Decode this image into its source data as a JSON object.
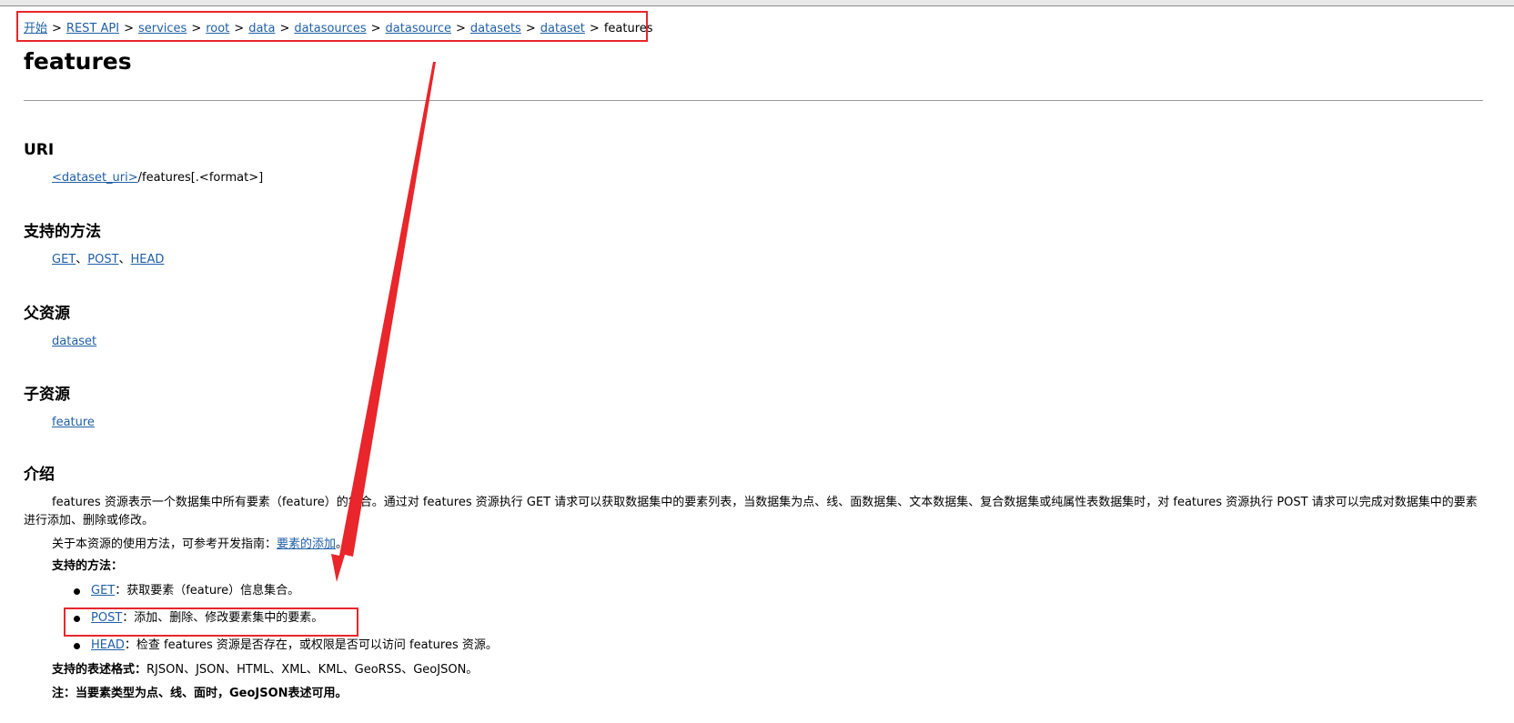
{
  "breadcrumb": {
    "items": [
      "开始",
      "REST API",
      "services",
      "root",
      "data",
      "datasources",
      "datasource",
      "datasets",
      "dataset"
    ],
    "current": "features",
    "separator": ">"
  },
  "page": {
    "title": "features"
  },
  "uri": {
    "heading": "URI",
    "link": "<dataset_uri>",
    "suffix": "/features[.<format>]"
  },
  "supported_methods": {
    "heading": "支持的方法",
    "links": [
      "GET",
      "POST",
      "HEAD"
    ],
    "separator": "、"
  },
  "parent": {
    "heading": "父资源",
    "link": "dataset"
  },
  "children": {
    "heading": "子资源",
    "link": "feature"
  },
  "intro": {
    "heading": "介绍",
    "paragraph": "features 资源表示一个数据集中所有要素（feature）的集合。通过对 features 资源执行 GET 请求可以获取数据集中的要素列表，当数据集为点、线、面数据集、文本数据集、复合数据集或纯属性表数据集时，对 features 资源执行 POST 请求可以完成对数据集中的要素进行添加、删除或修改。",
    "guide_prefix": "关于本资源的使用方法，可参考开发指南：",
    "guide_link": "要素的添加",
    "guide_suffix": "。",
    "methods_label": "支持的方法：",
    "methods": [
      {
        "name": "GET",
        "desc": "：获取要素（feature）信息集合。"
      },
      {
        "name": "POST",
        "desc": "：添加、删除、修改要素集中的要素。"
      },
      {
        "name": "HEAD",
        "desc": "：检查 features 资源是否存在，或权限是否可以访问 features 资源。"
      }
    ],
    "formats_label": "支持的表述格式：",
    "formats": "RJSON、JSON、HTML、XML、KML、GeoRSS、GeoJSON。",
    "note": "注：当要素类型为点、线、面时，GeoJSON表述可用。"
  },
  "colors": {
    "link": "#1f5fa6",
    "annotation": "#e8262b"
  }
}
